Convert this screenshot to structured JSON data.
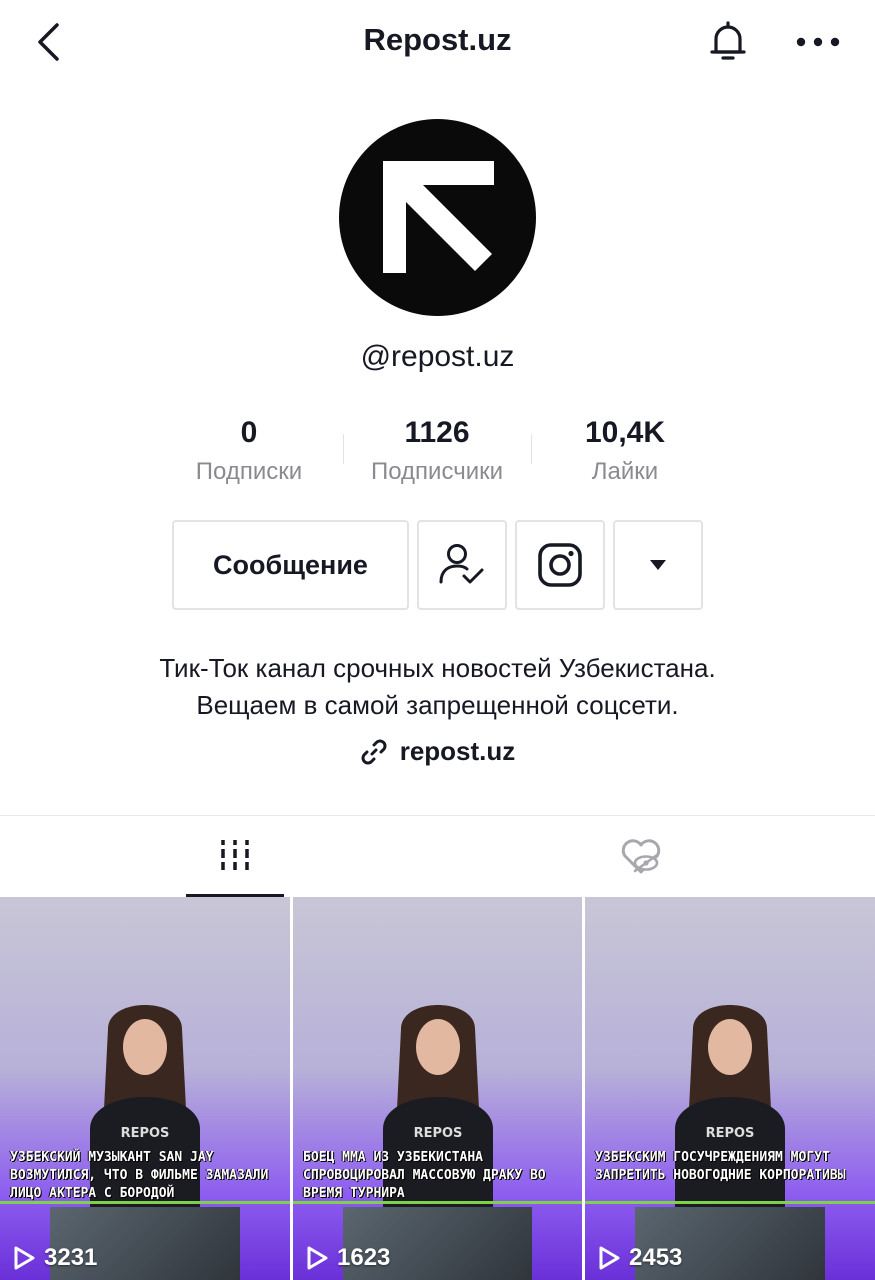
{
  "header": {
    "title": "Repost.uz"
  },
  "profile": {
    "handle": "@repost.uz",
    "stats": [
      {
        "value": "0",
        "label": "Подписки"
      },
      {
        "value": "1126",
        "label": "Подписчики"
      },
      {
        "value": "10,4K",
        "label": "Лайки"
      }
    ],
    "message_button": "Сообщение",
    "bio_line1": "Тик-Ток канал срочных новостей Узбекистана.",
    "bio_line2": "Вещаем в самой запрещенной соцсети.",
    "link": "repost.uz"
  },
  "tabs": [
    {
      "name": "videos",
      "icon": "grid-lines-icon",
      "active": true
    },
    {
      "name": "liked",
      "icon": "heart-hidden-icon",
      "active": false
    }
  ],
  "videos": [
    {
      "caption": "Узбекский музыкант San Jay возмутился, что в фильме замазали лицо актера с бородой",
      "views": "3231"
    },
    {
      "caption": "Боец ММА из Узбекистана спровоцировал массовую драку во время турнира",
      "views": "1623"
    },
    {
      "caption": "Узбекским госучреждениям могут запретить новогодние корпоративы",
      "views": "2453"
    }
  ],
  "colors": {
    "text": "#161823",
    "secondary": "#8a8b91",
    "border": "#e3e3e4",
    "caption_line": "#7fd14b"
  }
}
